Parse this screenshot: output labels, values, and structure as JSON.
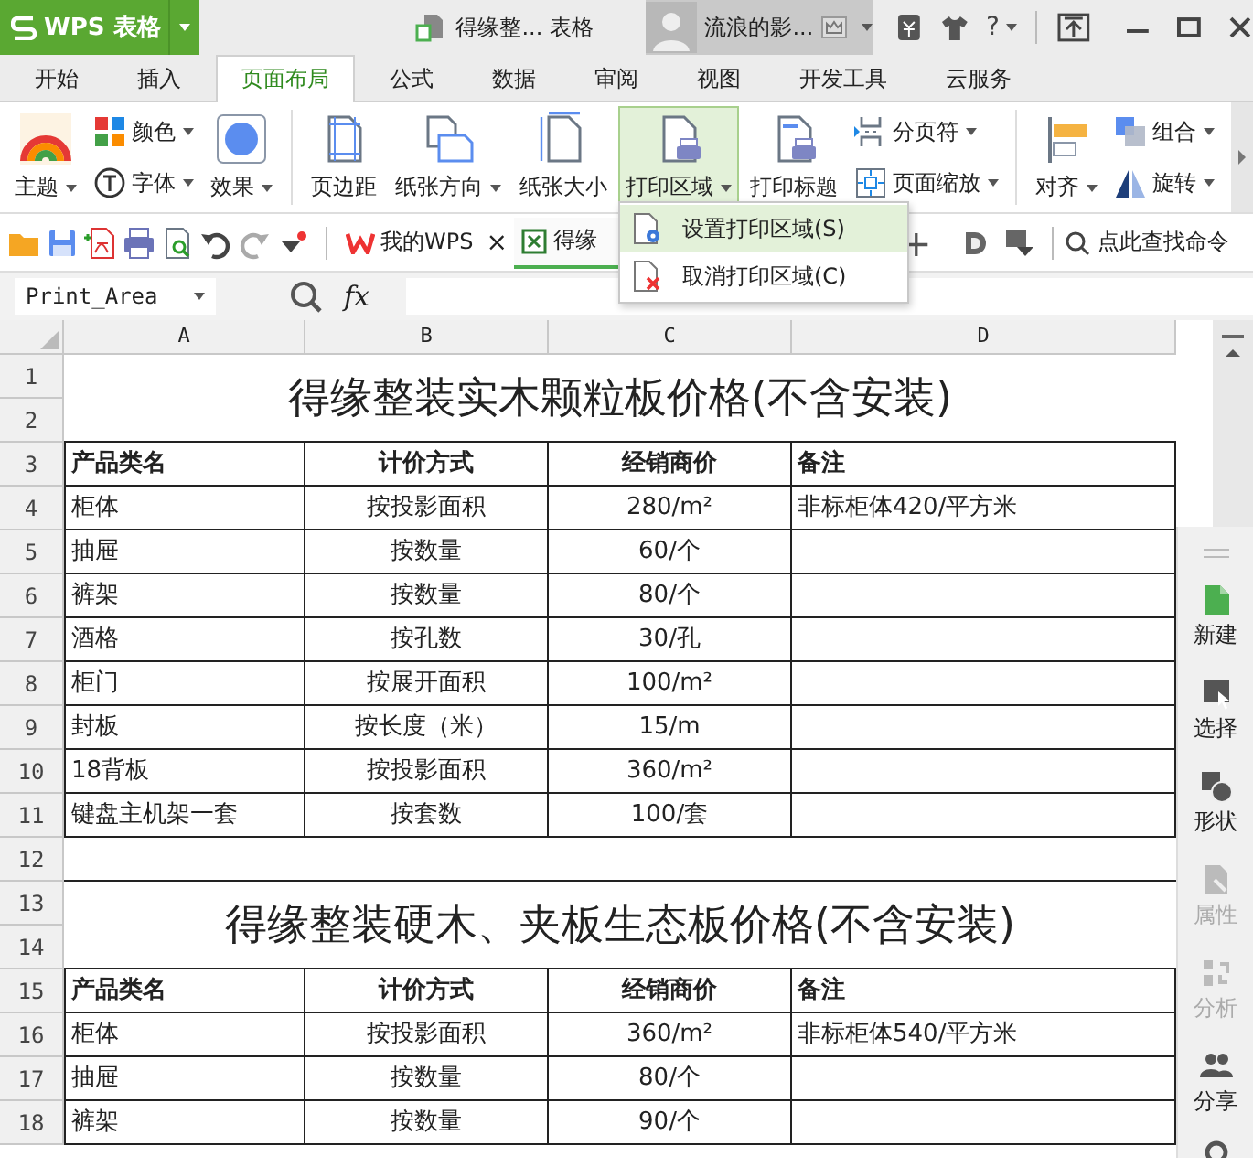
{
  "app": {
    "name": "WPS 表格"
  },
  "document_title": "得缘整... 表格",
  "user": {
    "name": "流浪的影..."
  },
  "help": "?",
  "tabs": [
    {
      "label": "开始",
      "selected": false
    },
    {
      "label": "插入",
      "selected": false
    },
    {
      "label": "页面布局",
      "selected": true
    },
    {
      "label": "公式",
      "selected": false
    },
    {
      "label": "数据",
      "selected": false
    },
    {
      "label": "审阅",
      "selected": false
    },
    {
      "label": "视图",
      "selected": false
    },
    {
      "label": "开发工具",
      "selected": false
    },
    {
      "label": "云服务",
      "selected": false
    }
  ],
  "ribbon": {
    "groups": [
      {
        "items": [
          {
            "kind": "large",
            "label": "主题",
            "dropdown": true,
            "pressed": false
          },
          {
            "kind": "small",
            "label": "颜色",
            "dropdown": true,
            "pressed": false
          },
          {
            "kind": "small",
            "label": "字体",
            "dropdown": true,
            "pressed": false
          },
          {
            "kind": "large",
            "label": "效果",
            "dropdown": true,
            "pressed": false
          }
        ]
      },
      {
        "items": [
          {
            "kind": "large",
            "label": "页边距",
            "dropdown": false,
            "pressed": false
          },
          {
            "kind": "large",
            "label": "纸张方向",
            "dropdown": true,
            "pressed": false
          },
          {
            "kind": "large",
            "label": "纸张大小",
            "dropdown": false,
            "pressed": false
          },
          {
            "kind": "large",
            "label": "打印区域",
            "dropdown": true,
            "pressed": true
          },
          {
            "kind": "large",
            "label": "打印标题",
            "dropdown": false,
            "pressed": false
          },
          {
            "kind": "small",
            "label": "分页符",
            "dropdown": true,
            "pressed": false
          },
          {
            "kind": "small",
            "label": "页面缩放",
            "dropdown": true,
            "pressed": false
          }
        ]
      },
      {
        "items": [
          {
            "kind": "large",
            "label": "对齐",
            "dropdown": true,
            "pressed": false
          },
          {
            "kind": "small",
            "label": "组合",
            "dropdown": true,
            "pressed": false
          },
          {
            "kind": "small",
            "label": "旋转",
            "dropdown": true,
            "pressed": false
          }
        ]
      }
    ]
  },
  "doc_tabs": [
    {
      "label": "我的WPS",
      "close": "×",
      "selected": false
    },
    {
      "label": "得缘",
      "selected": true
    }
  ],
  "new_tab": "+",
  "command_search": {
    "placeholder": "点此查找命令"
  },
  "menu": {
    "items": [
      {
        "label": "设置打印区域(S)",
        "selected": true
      },
      {
        "label": "取消打印区域(C)",
        "selected": false
      }
    ]
  },
  "formula_bar": {
    "name_box": "Print_Area",
    "fx": "fx"
  },
  "sheet": {
    "columns": [
      "A",
      "B",
      "C",
      "D"
    ],
    "rows": [
      {
        "kind": "title",
        "numbers": [
          "1",
          "2"
        ],
        "text": "得缘整装实木颗粒板价格(不含安装)"
      },
      {
        "kind": "header",
        "numbers": [
          "3"
        ],
        "cells": [
          "产品类名",
          "计价方式",
          "经销商价",
          "备注"
        ]
      },
      {
        "kind": "data",
        "numbers": [
          "4"
        ],
        "cells": [
          "柜体",
          "按投影面积",
          "280/m²",
          "非标柜体420/平方米"
        ]
      },
      {
        "kind": "data",
        "numbers": [
          "5"
        ],
        "cells": [
          "抽屉",
          "按数量",
          "60/个"
        ]
      },
      {
        "kind": "data",
        "numbers": [
          "6"
        ],
        "cells": [
          "裤架",
          "按数量",
          "80/个"
        ]
      },
      {
        "kind": "data",
        "numbers": [
          "7"
        ],
        "cells": [
          "酒格",
          "按孔数",
          "30/孔"
        ]
      },
      {
        "kind": "data",
        "numbers": [
          "8"
        ],
        "cells": [
          "柜门",
          "按展开面积",
          "100/m²"
        ]
      },
      {
        "kind": "data",
        "numbers": [
          "9"
        ],
        "cells": [
          "封板",
          "按长度（米）",
          "15/m"
        ]
      },
      {
        "kind": "data",
        "numbers": [
          "10"
        ],
        "cells": [
          "18背板",
          "按投影面积",
          "360/m²"
        ]
      },
      {
        "kind": "data",
        "numbers": [
          "11"
        ],
        "cells": [
          "键盘主机架一套",
          "按套数",
          "100/套"
        ]
      },
      {
        "kind": "blank",
        "numbers": [
          "12"
        ]
      },
      {
        "kind": "title",
        "numbers": [
          "13",
          "14"
        ],
        "text": "得缘整装硬木、夹板生态板价格(不含安装)"
      },
      {
        "kind": "header",
        "numbers": [
          "15"
        ],
        "cells": [
          "产品类名",
          "计价方式",
          "经销商价",
          "备注"
        ]
      },
      {
        "kind": "data",
        "numbers": [
          "16"
        ],
        "cells": [
          "柜体",
          "按投影面积",
          "360/m²",
          "非标柜体540/平方米"
        ]
      },
      {
        "kind": "data",
        "numbers": [
          "17"
        ],
        "cells": [
          "抽屉",
          "按数量",
          "80/个"
        ]
      },
      {
        "kind": "data",
        "numbers": [
          "18"
        ],
        "cells": [
          "裤架",
          "按数量",
          "90/个"
        ]
      }
    ]
  },
  "side_panel": {
    "items": [
      {
        "label": "新建",
        "disabled": false
      },
      {
        "label": "选择",
        "disabled": false
      },
      {
        "label": "形状",
        "disabled": false
      },
      {
        "label": "属性",
        "disabled": true
      },
      {
        "label": "分析",
        "disabled": true
      },
      {
        "label": "分享",
        "disabled": false
      }
    ]
  }
}
